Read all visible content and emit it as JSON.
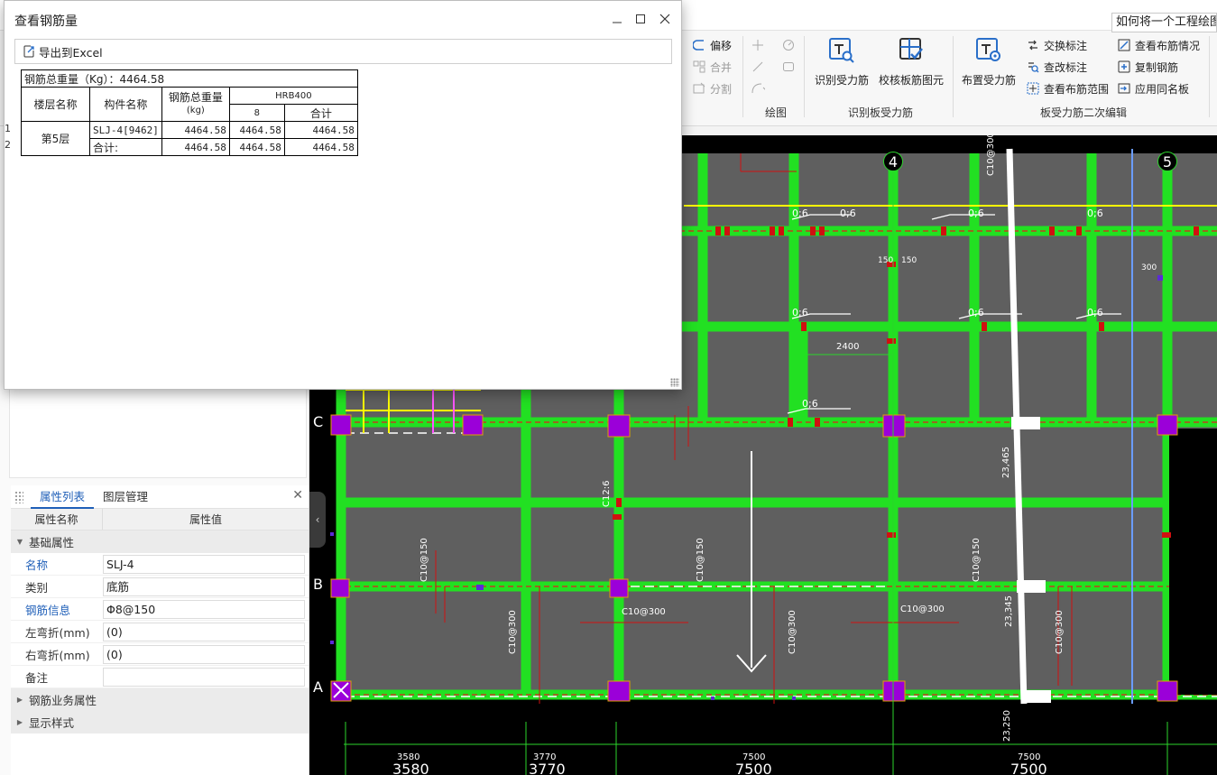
{
  "help_search": "如何将一个工程绘图界",
  "ribbon": {
    "edit_group": {
      "offset": "偏移",
      "merge": "合并",
      "split": "分割"
    },
    "draw_group": {
      "label": "绘图"
    },
    "recognize_group": {
      "label": "识别板受力筋",
      "recognize": "识别受力筋",
      "check": "校核板筋图元"
    },
    "secondary_group": {
      "label": "板受力筋二次编辑",
      "place": "布置受力筋",
      "swap_label": "交换标注",
      "check_modify_label": "查改标注",
      "view_range": "查看布筋范围",
      "view_layout": "查看布筋情况",
      "copy_rebar": "复制钢筋",
      "apply_same_name": "应用同名板"
    }
  },
  "dialog": {
    "title": "查看钢筋量",
    "export_label": "导出到Excel",
    "total_row": "钢筋总重量（Kg）：4464.58",
    "headers": {
      "floor": "楼层名称",
      "component": "构件名称",
      "total_weight_line1": "钢筋总重量",
      "total_weight_line2": "(kg)",
      "grade": "HRB400",
      "diameter": "8",
      "subtotal": "合计"
    },
    "rows": [
      {
        "floor": "第5层",
        "component": "SLJ-4[9462]",
        "total": "4464.58",
        "d8": "4464.58",
        "sum": "4464.58"
      },
      {
        "component": "合计:",
        "total": "4464.58",
        "d8": "4464.58",
        "sum": "4464.58"
      }
    ],
    "row_markers": [
      "1",
      "2"
    ]
  },
  "properties_panel": {
    "tab_active": "属性列表",
    "tab_other": "图层管理",
    "col_name": "属性名称",
    "col_value": "属性值",
    "section_basic": "基础属性",
    "rows": [
      {
        "name": "名称",
        "value": "SLJ-4"
      },
      {
        "name": "类别",
        "value": "底筋"
      },
      {
        "name": "钢筋信息",
        "value": "Φ8@150"
      },
      {
        "name": "左弯折(mm)",
        "value": "(0)"
      },
      {
        "name": "右弯折(mm)",
        "value": "(0)"
      },
      {
        "name": "备注",
        "value": ""
      }
    ],
    "section_business": "钢筋业务属性",
    "section_display": "显示样式"
  },
  "canvas": {
    "axis_top": [
      "4",
      "5"
    ],
    "axis_left": [
      "C",
      "B",
      "A"
    ],
    "dims_small": [
      "3580",
      "3770",
      "7500",
      "7500"
    ],
    "dims_big": [
      "3580",
      "3770",
      "7500",
      "7500"
    ],
    "annotations": {
      "c12": "C12:6",
      "c10_a": "C10@150",
      "c10_b": "C10@150",
      "c10_c": "C10@150",
      "c10_300_a": "C10@300",
      "c10_300_b": "C10@300",
      "c10_300_c": "C10@300",
      "c10_300_d": "C10@300",
      "c10_300_e": "C10@300",
      "c10_300_f": "C10@300",
      "n2400": "2400",
      "n150a": "150",
      "n150b": "150",
      "n300": "300",
      "n23465": "23,465",
      "n23345": "23,345",
      "n23250": "23,250",
      "n06": "0;6"
    }
  },
  "colors": {
    "beam": "#22e022",
    "slab": "#5f5f5f",
    "column": "#9b00d9",
    "accent": "#1f5fb8"
  }
}
